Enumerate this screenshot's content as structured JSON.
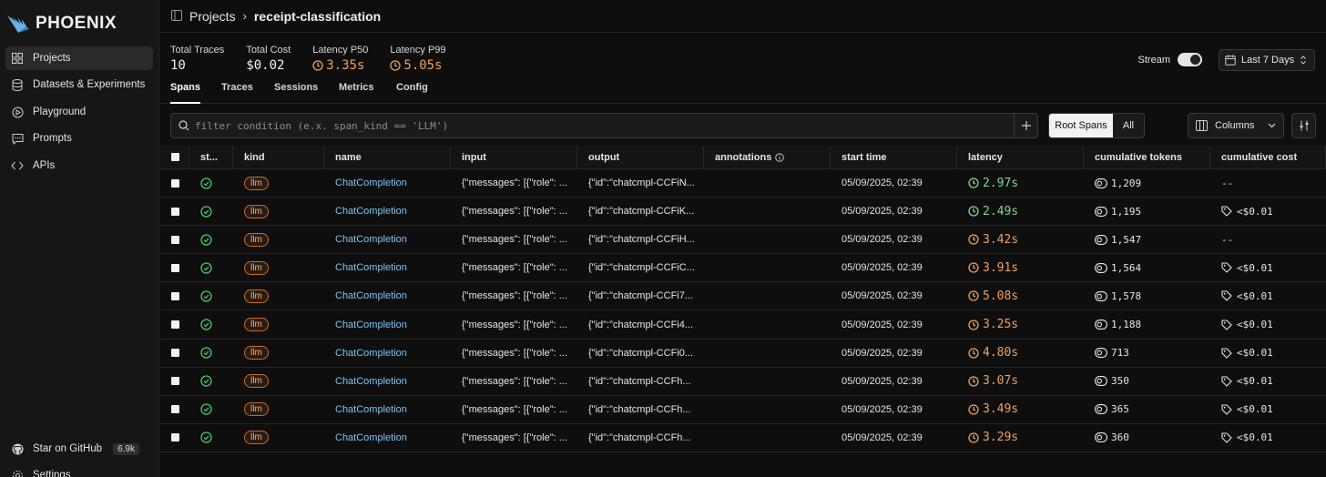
{
  "sidebar": {
    "logo": "PHOENIX",
    "items": [
      {
        "label": "Projects",
        "icon": "grid-icon",
        "active": true
      },
      {
        "label": "Datasets & Experiments",
        "icon": "database-icon"
      },
      {
        "label": "Playground",
        "icon": "play-icon"
      },
      {
        "label": "Prompts",
        "icon": "chat-icon"
      },
      {
        "label": "APIs",
        "icon": "code-icon"
      }
    ],
    "github": {
      "label": "Star on GitHub",
      "count": "6.9k"
    },
    "settings": "Settings"
  },
  "breadcrumb": {
    "parent": "Projects",
    "separator": "›",
    "current": "receipt-classification"
  },
  "stats": {
    "total_traces": {
      "label": "Total Traces",
      "value": "10"
    },
    "total_cost": {
      "label": "Total Cost",
      "value": "$0.02"
    },
    "latency_p50": {
      "label": "Latency P50",
      "value": "3.35s"
    },
    "latency_p99": {
      "label": "Latency P99",
      "value": "5.05s"
    }
  },
  "stream": {
    "label": "Stream",
    "on": true
  },
  "date_range": "Last 7 Days",
  "tabs": [
    "Spans",
    "Traces",
    "Sessions",
    "Metrics",
    "Config"
  ],
  "filter": {
    "placeholder": "filter condition (e.x. span_kind == 'LLM')"
  },
  "segment": {
    "root": "Root Spans",
    "all": "All"
  },
  "columns_button": "Columns",
  "table": {
    "headers": [
      "st...",
      "kind",
      "name",
      "input",
      "output",
      "annotations",
      "start time",
      "latency",
      "cumulative tokens",
      "cumulative cost"
    ],
    "rows": [
      {
        "kind": "llm",
        "name": "ChatCompletion",
        "input": "{\"messages\": [{\"role\": ...",
        "output": "{\"id\":\"chatcmpl-CCFiN...",
        "start": "05/09/2025, 02:39",
        "latency": "2.97s",
        "lat_color": "#7fd88a",
        "tokens": "1,209",
        "cost": "--"
      },
      {
        "kind": "llm",
        "name": "ChatCompletion",
        "input": "{\"messages\": [{\"role\": ...",
        "output": "{\"id\":\"chatcmpl-CCFiK...",
        "start": "05/09/2025, 02:39",
        "latency": "2.49s",
        "lat_color": "#7fd88a",
        "tokens": "1,195",
        "cost": "<$0.01"
      },
      {
        "kind": "llm",
        "name": "ChatCompletion",
        "input": "{\"messages\": [{\"role\": ...",
        "output": "{\"id\":\"chatcmpl-CCFiH...",
        "start": "05/09/2025, 02:39",
        "latency": "3.42s",
        "lat_color": "#f0a15a",
        "tokens": "1,547",
        "cost": "--"
      },
      {
        "kind": "llm",
        "name": "ChatCompletion",
        "input": "{\"messages\": [{\"role\": ...",
        "output": "{\"id\":\"chatcmpl-CCFiC...",
        "start": "05/09/2025, 02:39",
        "latency": "3.91s",
        "lat_color": "#f0a15a",
        "tokens": "1,564",
        "cost": "<$0.01"
      },
      {
        "kind": "llm",
        "name": "ChatCompletion",
        "input": "{\"messages\": [{\"role\": ...",
        "output": "{\"id\":\"chatcmpl-CCFi7...",
        "start": "05/09/2025, 02:39",
        "latency": "5.08s",
        "lat_color": "#f0a15a",
        "tokens": "1,578",
        "cost": "<$0.01"
      },
      {
        "kind": "llm",
        "name": "ChatCompletion",
        "input": "{\"messages\": [{\"role\": ...",
        "output": "{\"id\":\"chatcmpl-CCFi4...",
        "start": "05/09/2025, 02:39",
        "latency": "3.25s",
        "lat_color": "#f0a15a",
        "tokens": "1,188",
        "cost": "<$0.01"
      },
      {
        "kind": "llm",
        "name": "ChatCompletion",
        "input": "{\"messages\": [{\"role\": ...",
        "output": "{\"id\":\"chatcmpl-CCFi0...",
        "start": "05/09/2025, 02:39",
        "latency": "4.80s",
        "lat_color": "#f0a15a",
        "tokens": "713",
        "cost": "<$0.01"
      },
      {
        "kind": "llm",
        "name": "ChatCompletion",
        "input": "{\"messages\": [{\"role\": ...",
        "output": "{\"id\":\"chatcmpl-CCFh...",
        "start": "05/09/2025, 02:39",
        "latency": "3.07s",
        "lat_color": "#f0a15a",
        "tokens": "350",
        "cost": "<$0.01"
      },
      {
        "kind": "llm",
        "name": "ChatCompletion",
        "input": "{\"messages\": [{\"role\": ...",
        "output": "{\"id\":\"chatcmpl-CCFh...",
        "start": "05/09/2025, 02:39",
        "latency": "3.49s",
        "lat_color": "#f0a15a",
        "tokens": "365",
        "cost": "<$0.01"
      },
      {
        "kind": "llm",
        "name": "ChatCompletion",
        "input": "{\"messages\": [{\"role\": ...",
        "output": "{\"id\":\"chatcmpl-CCFh...",
        "start": "05/09/2025, 02:39",
        "latency": "3.29s",
        "lat_color": "#f0a15a",
        "tokens": "360",
        "cost": "<$0.01"
      }
    ]
  },
  "colors": {
    "accent_orange": "#f0a15a",
    "accent_green": "#7fd88a",
    "link_blue": "#7fc3ef",
    "status_ok": "#4cc764"
  }
}
